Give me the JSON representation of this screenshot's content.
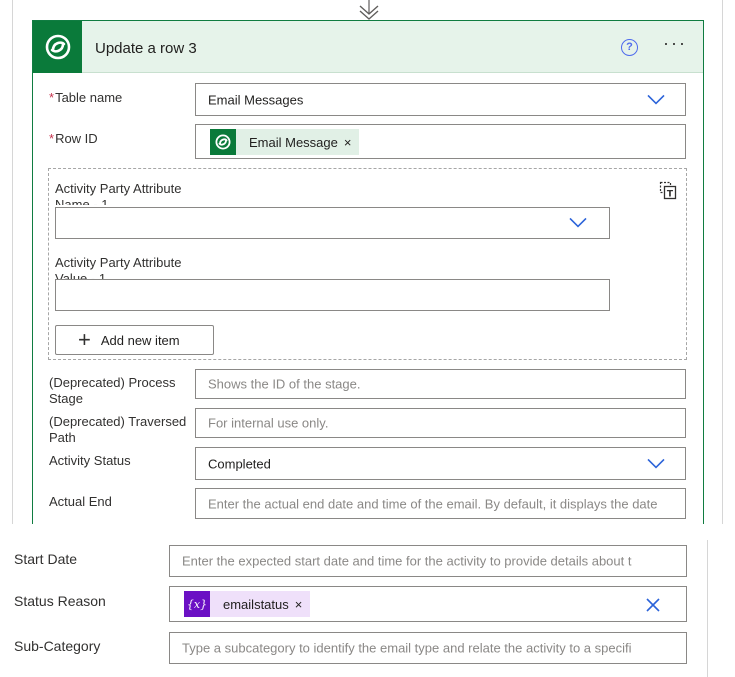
{
  "card": {
    "title": "Update a row 3",
    "help_glyph": "?",
    "more_glyph": "···",
    "colors": {
      "accent": "#0a7a3a",
      "header_bg": "#e6f3ea"
    }
  },
  "fields": {
    "table_name": {
      "label": "Table name",
      "required": "*",
      "value": "Email Messages"
    },
    "row_id": {
      "label": "Row ID",
      "required": "*",
      "token": "Email Message",
      "remove": "×"
    },
    "activity_party": {
      "name_label": "Activity Party Attribute Name - 1",
      "value_label": "Activity Party Attribute Value - 1",
      "add_label": "Add new item",
      "add_glyph": "+"
    },
    "process_stage": {
      "label": "(Deprecated) Process Stage",
      "placeholder": "Shows the ID of the stage."
    },
    "traversed_path": {
      "label": "(Deprecated) Traversed Path",
      "placeholder": "For internal use only."
    },
    "activity_status": {
      "label": "Activity Status",
      "value": "Completed"
    },
    "actual_end": {
      "label": "Actual End",
      "placeholder": "Enter the actual end date and time of the email. By default, it displays the date"
    }
  },
  "lower": {
    "start_date": {
      "label": "Start Date",
      "placeholder": "Enter the expected start date and time for the activity to provide details about t"
    },
    "status_reason": {
      "label": "Status Reason",
      "token": "emailstatus",
      "token_icon": "{x}",
      "remove": "×"
    },
    "sub_category": {
      "label": "Sub-Category",
      "placeholder": "Type a subcategory to identify the email type and relate the activity to a specifi"
    }
  }
}
